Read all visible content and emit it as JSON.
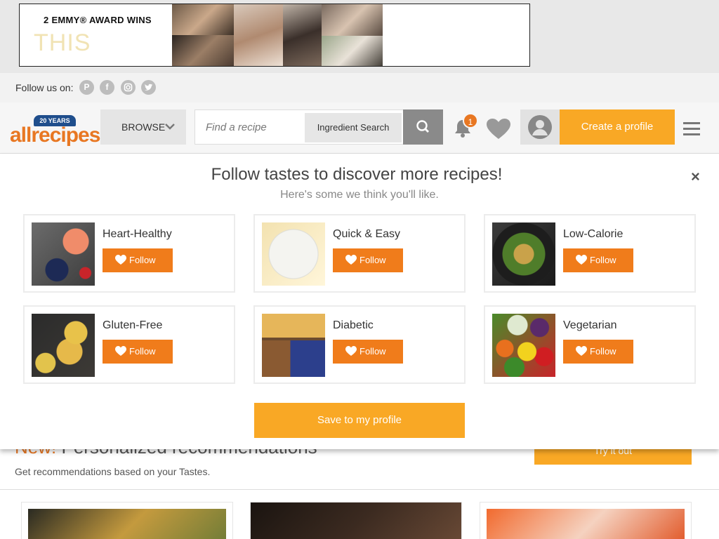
{
  "ad": {
    "headline": "2 EMMY® AWARD WINS",
    "word": "THIS"
  },
  "follow_bar": {
    "label": "Follow us on:",
    "icons": [
      "pinterest-icon",
      "facebook-icon",
      "instagram-icon",
      "twitter-icon"
    ]
  },
  "header": {
    "logo_text": "allrecipes",
    "logo_badge": "20 YEARS",
    "browse_label": "BROWSE",
    "search_placeholder": "Find a recipe",
    "ingredient_search_label": "Ingredient Search",
    "notification_count": "1",
    "create_profile_label": "Create a profile"
  },
  "modal": {
    "title": "Follow tastes to discover more recipes!",
    "subtitle": "Here's some we think you'll like.",
    "close_label": "×",
    "follow_label": "Follow",
    "tastes": [
      {
        "name": "Heart-Healthy"
      },
      {
        "name": "Quick & Easy"
      },
      {
        "name": "Low-Calorie"
      },
      {
        "name": "Gluten-Free"
      },
      {
        "name": "Diabetic"
      },
      {
        "name": "Vegetarian"
      }
    ],
    "save_label": "Save to my profile"
  },
  "below": {
    "title_new": "New!",
    "title_rest": " Personalized recommendations",
    "try_label": "Try it out",
    "description": "Get recommendations based on your Tastes."
  },
  "colors": {
    "accent_orange": "#f07c1b",
    "button_yellow": "#f9a825",
    "logo_blue": "#1f4e8c"
  }
}
